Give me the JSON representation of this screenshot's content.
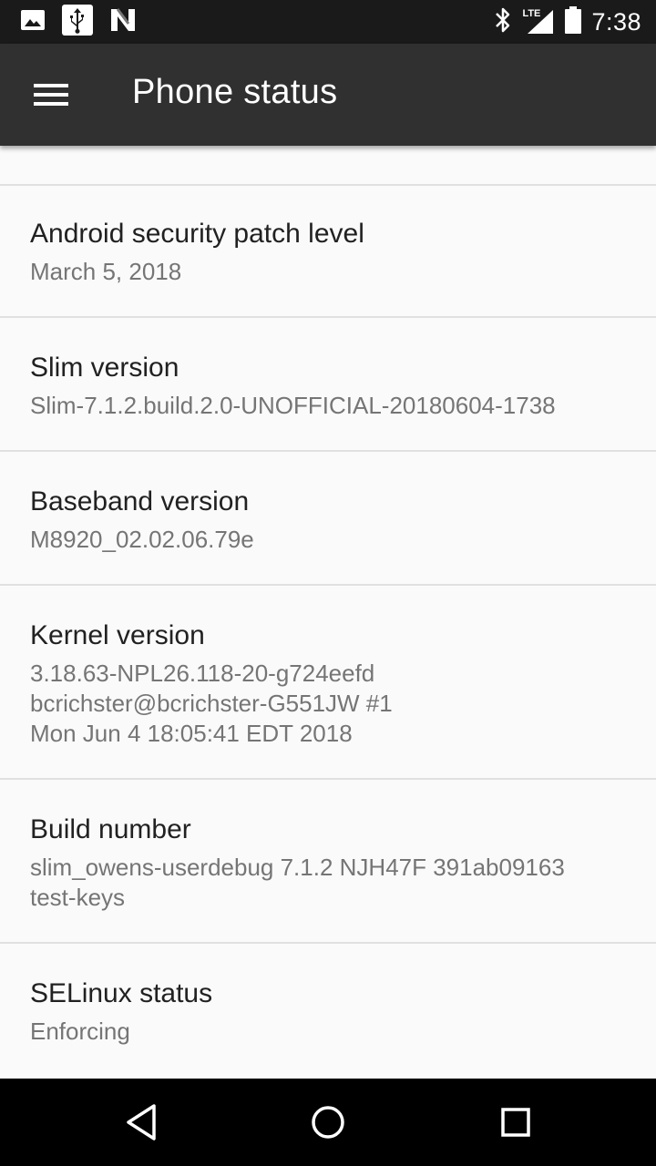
{
  "status_bar": {
    "left_icons": [
      "image-icon",
      "usb-icon",
      "n-logo-icon"
    ],
    "right_icons": [
      "bluetooth-icon",
      "lte-signal-icon",
      "battery-icon"
    ],
    "lte_label": "LTE",
    "time": "7:38"
  },
  "app_bar": {
    "title": "Phone status",
    "menu_icon": "hamburger-menu-icon"
  },
  "items": [
    {
      "title": "Android security patch level",
      "value": "March 5, 2018"
    },
    {
      "title": "Slim version",
      "value": "Slim-7.1.2.build.2.0-UNOFFICIAL-20180604-1738"
    },
    {
      "title": "Baseband version",
      "value": "M8920_02.02.06.79e"
    },
    {
      "title": "Kernel version",
      "value": "3.18.63-NPL26.118-20-g724eefd\nbcrichster@bcrichster-G551JW #1\nMon Jun 4 18:05:41 EDT 2018"
    },
    {
      "title": "Build number",
      "value": "slim_owens-userdebug 7.1.2 NJH47F 391ab09163\ntest-keys"
    },
    {
      "title": "SELinux status",
      "value": "Enforcing"
    }
  ],
  "nav_bar": {
    "icons": [
      "back-icon",
      "home-icon",
      "recents-icon"
    ]
  },
  "colors": {
    "status_bar": "#1a1a1a",
    "app_bar": "#303030",
    "background": "#fafafa",
    "divider": "#e0e0e0",
    "title_text": "#212121",
    "value_text": "#757575"
  }
}
